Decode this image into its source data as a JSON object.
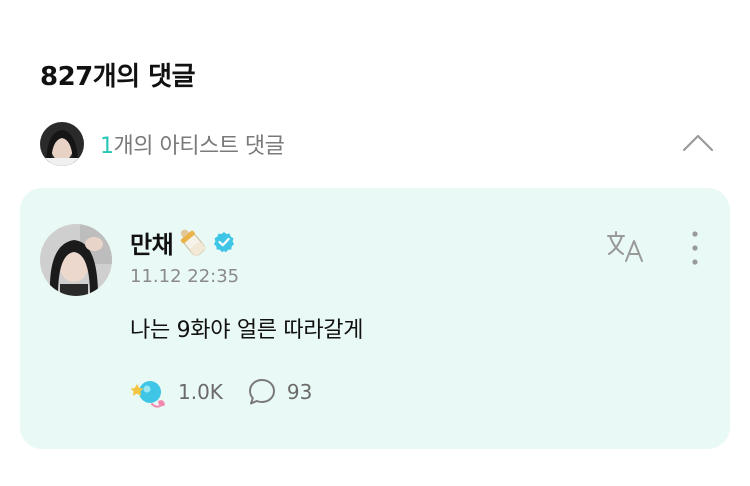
{
  "header": {
    "title": "827개의 댓글"
  },
  "artist_section": {
    "count": "1",
    "label": "개의 아티스트 댓글",
    "collapse_icon": "chevron-up-icon"
  },
  "comment": {
    "author": "만채",
    "author_emoji": "baby-bottle-icon",
    "verified_icon": "verified-badge-icon",
    "timestamp": "11.12 22:35",
    "text": "나는 9화야 얼른 따라갈게",
    "like_count": "1.0K",
    "reply_count": "93",
    "translate_icon": "translate-icon",
    "more_icon": "more-vertical-icon"
  },
  "colors": {
    "accent": "#27c6b8",
    "card_bg": "#e9f9f5",
    "verified": "#3fc6e6",
    "muted_text": "#8a8a8a"
  }
}
